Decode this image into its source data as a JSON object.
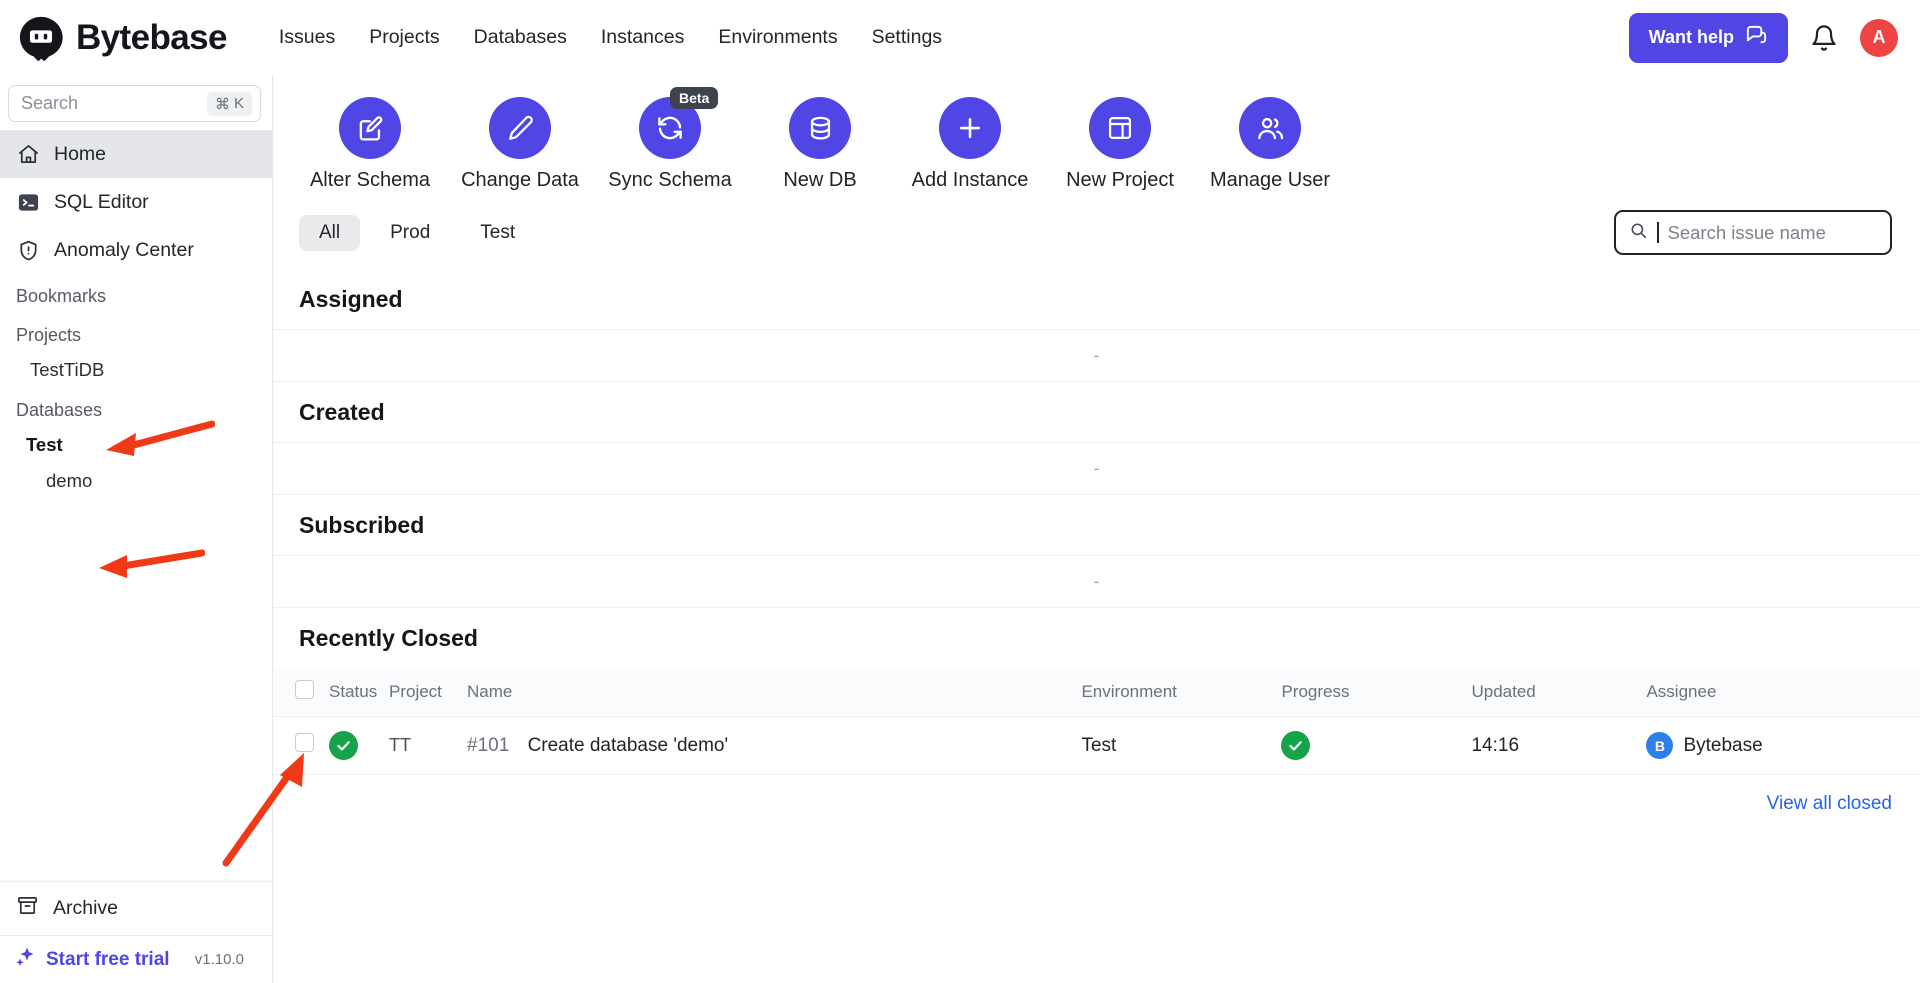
{
  "header": {
    "brand": "Bytebase",
    "brand_icon": "bytebase-logo-icon",
    "nav": [
      {
        "label": "Issues"
      },
      {
        "label": "Projects"
      },
      {
        "label": "Databases"
      },
      {
        "label": "Instances"
      },
      {
        "label": "Environments"
      },
      {
        "label": "Settings"
      }
    ],
    "help_button": {
      "label": "Want help",
      "icon": "chat-bubble-icon",
      "color": "#4f46e5"
    },
    "notification_icon": "bell-icon",
    "avatar": {
      "initial": "A",
      "color": "#ef4444"
    }
  },
  "sidebar": {
    "search": {
      "placeholder": "Search",
      "shortcut_mod": "⌘",
      "shortcut_key": "K"
    },
    "items": [
      {
        "label": "Home",
        "icon": "home-icon",
        "active": true
      },
      {
        "label": "SQL Editor",
        "icon": "terminal-icon",
        "active": false
      },
      {
        "label": "Anomaly Center",
        "icon": "shield-alert-icon",
        "active": false
      }
    ],
    "bookmarks_label": "Bookmarks",
    "projects_label": "Projects",
    "projects": [
      {
        "label": "TestTiDB"
      }
    ],
    "databases_label": "Databases",
    "databases": [
      {
        "label": "Test",
        "bold": true
      },
      {
        "label": "demo",
        "bold": false
      }
    ],
    "archive": {
      "label": "Archive",
      "icon": "archive-icon"
    },
    "trial": {
      "label": "Start free trial",
      "icon": "sparkles-icon",
      "color": "#4f46e5"
    },
    "version": "v1.10.0"
  },
  "quick_actions": [
    {
      "label": "Alter Schema",
      "icon": "pencil-square-icon",
      "badge": null
    },
    {
      "label": "Change Data",
      "icon": "pencil-icon",
      "badge": null
    },
    {
      "label": "Sync Schema",
      "icon": "refresh-icon",
      "badge": "Beta"
    },
    {
      "label": "New DB",
      "icon": "database-icon",
      "badge": null
    },
    {
      "label": "Add Instance",
      "icon": "plus-icon",
      "badge": null
    },
    {
      "label": "New Project",
      "icon": "layout-grid-icon",
      "badge": null
    },
    {
      "label": "Manage User",
      "icon": "users-icon",
      "badge": null
    }
  ],
  "filters": {
    "tabs": [
      {
        "label": "All",
        "active": true
      },
      {
        "label": "Prod",
        "active": false
      },
      {
        "label": "Test",
        "active": false
      }
    ],
    "search": {
      "placeholder": "Search issue name",
      "value": "",
      "icon": "search-icon"
    }
  },
  "sections": [
    {
      "title": "Assigned",
      "empty_text": "-"
    },
    {
      "title": "Created",
      "empty_text": "-"
    },
    {
      "title": "Subscribed",
      "empty_text": "-"
    }
  ],
  "recently_closed": {
    "title": "Recently Closed",
    "columns": {
      "status": "Status",
      "project": "Project",
      "name": "Name",
      "environment": "Environment",
      "progress": "Progress",
      "updated": "Updated",
      "assignee": "Assignee"
    },
    "rows": [
      {
        "status_icon": "check-circle-green-icon",
        "project": "TT",
        "issue_id": "#101",
        "name": "Create database 'demo'",
        "environment": "Test",
        "progress_icon": "check-circle-green-icon",
        "updated": "14:16",
        "assignee": {
          "initial": "B",
          "name": "Bytebase",
          "color": "#2f7fe8"
        }
      }
    ],
    "view_all_label": "View all closed"
  },
  "annotations": {
    "color": "#f03a17",
    "arrows": [
      {
        "target": "sidebar-project-TestTiDB"
      },
      {
        "target": "sidebar-database-demo"
      },
      {
        "target": "recently-closed-row-status"
      }
    ]
  }
}
